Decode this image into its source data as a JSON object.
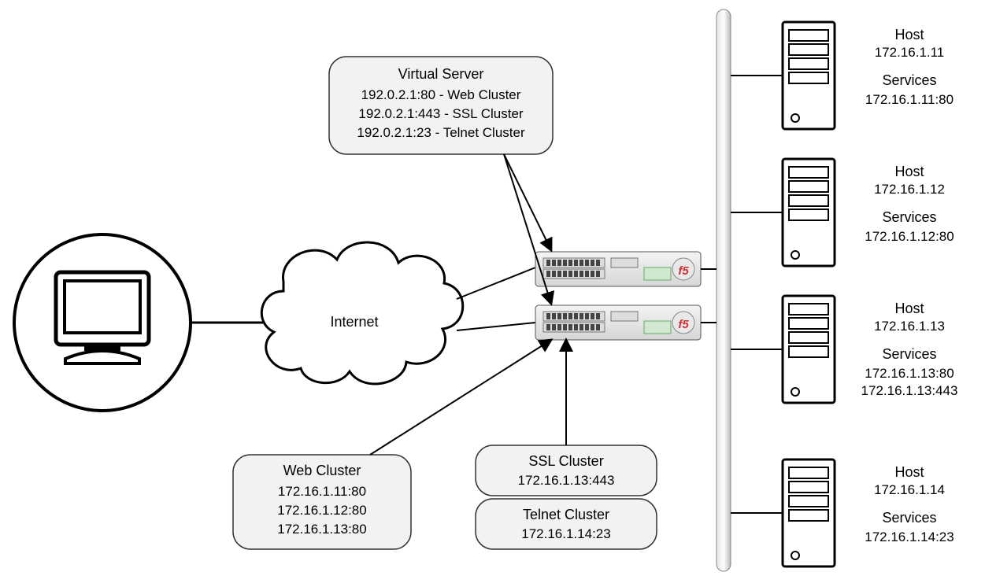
{
  "internet_label": "Internet",
  "virtual_server": {
    "title": "Virtual Server",
    "lines": [
      "192.0.2.1:80 - Web Cluster",
      "192.0.2.1:443 - SSL Cluster",
      "192.0.2.1:23 - Telnet Cluster"
    ]
  },
  "web_cluster": {
    "title": "Web Cluster",
    "lines": [
      "172.16.1.11:80",
      "172.16.1.12:80",
      "172.16.1.13:80"
    ]
  },
  "ssl_cluster": {
    "title": "SSL Cluster",
    "lines": [
      "172.16.1.13:443"
    ]
  },
  "telnet_cluster": {
    "title": "Telnet Cluster",
    "lines": [
      "172.16.1.14:23"
    ]
  },
  "hosts": [
    {
      "host_label": "Host",
      "host_ip": "172.16.1.11",
      "svc_label": "Services",
      "svc_lines": [
        "172.16.1.11:80"
      ]
    },
    {
      "host_label": "Host",
      "host_ip": "172.16.1.12",
      "svc_label": "Services",
      "svc_lines": [
        "172.16.1.12:80"
      ]
    },
    {
      "host_label": "Host",
      "host_ip": "172.16.1.13",
      "svc_label": "Services",
      "svc_lines": [
        "172.16.1.13:80",
        "172.16.1.13:443"
      ]
    },
    {
      "host_label": "Host",
      "host_ip": "172.16.1.14",
      "svc_label": "Services",
      "svc_lines": [
        "172.16.1.14:23"
      ]
    }
  ]
}
